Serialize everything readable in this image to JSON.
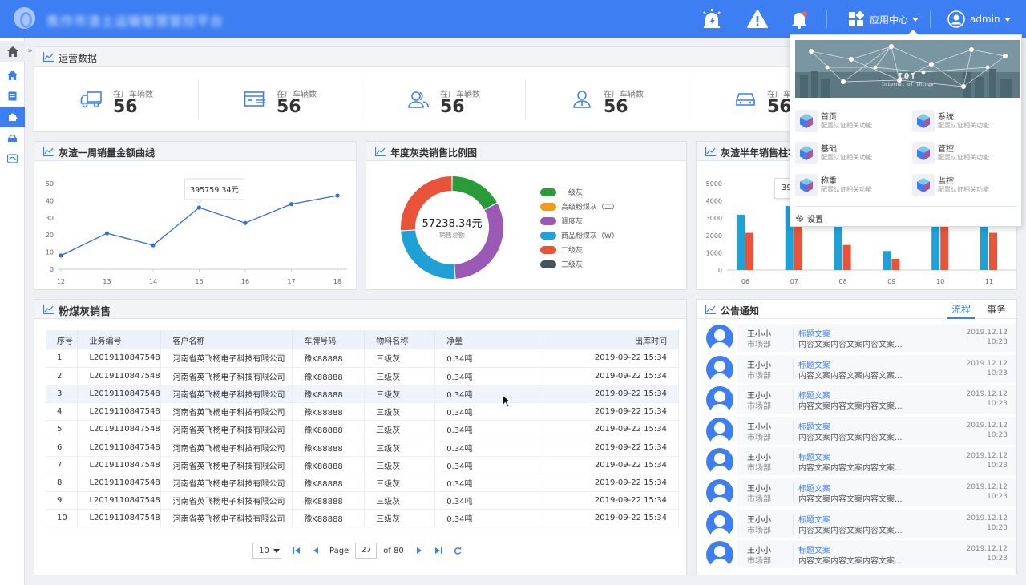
{
  "header": {
    "brand": "焦作市渣土运输智慧管控平台",
    "app_center": "应用中心",
    "user": "admin",
    "icons": [
      "alarm-icon",
      "warning-icon",
      "bell-icon"
    ]
  },
  "ops": {
    "title": "运营数据",
    "stats": [
      {
        "label": "在厂车辆数",
        "value": "56",
        "icon": "truck-icon"
      },
      {
        "label": "在厂车辆数",
        "value": "56",
        "icon": "card-icon"
      },
      {
        "label": "在厂车辆数",
        "value": "56",
        "icon": "users-icon"
      },
      {
        "label": "在厂车辆数",
        "value": "56",
        "icon": "driver-icon"
      },
      {
        "label": "在厂车辆数",
        "value": "56",
        "icon": "car-icon"
      }
    ]
  },
  "line_panel": {
    "title": "灰渣一周销量金额曲线",
    "tooltip": "395759.34元"
  },
  "donut_panel": {
    "title": "年度灰类销售比例图",
    "center_value": "57238.34元",
    "center_label": "销售总额"
  },
  "bar_panel": {
    "title": "灰渣半年销售柱状图",
    "tooltip_partial": "39"
  },
  "table_panel": {
    "title": "粉煤灰销售",
    "headers": [
      "序号",
      "业务编号",
      "客户名称",
      "车牌号码",
      "物料名称",
      "净量",
      "出库时间"
    ],
    "rows": [
      [
        "1",
        "L2019110847548",
        "河南省英飞杨电子科技有限公司",
        "豫K88888",
        "三级灰",
        "0.34吨",
        "2019-09-22  15:34"
      ],
      [
        "2",
        "L2019110847548",
        "河南省英飞杨电子科技有限公司",
        "豫K88888",
        "三级灰",
        "0.34吨",
        "2019-09-22  15:34"
      ],
      [
        "3",
        "L2019110847548",
        "河南省英飞杨电子科技有限公司",
        "豫K88888",
        "三级灰",
        "0.34吨",
        "2019-09-22  15:34"
      ],
      [
        "4",
        "L2019110847548",
        "河南省英飞杨电子科技有限公司",
        "豫K88888",
        "三级灰",
        "0.34吨",
        "2019-09-22  15:34"
      ],
      [
        "5",
        "L2019110847548",
        "河南省英飞杨电子科技有限公司",
        "豫K88888",
        "三级灰",
        "0.34吨",
        "2019-09-22  15:34"
      ],
      [
        "6",
        "L2019110847548",
        "河南省英飞杨电子科技有限公司",
        "豫K88888",
        "三级灰",
        "0.34吨",
        "2019-09-22  15:34"
      ],
      [
        "7",
        "L2019110847548",
        "河南省英飞杨电子科技有限公司",
        "豫K88888",
        "三级灰",
        "0.34吨",
        "2019-09-22  15:34"
      ],
      [
        "8",
        "L2019110847548",
        "河南省英飞杨电子科技有限公司",
        "豫K88888",
        "三级灰",
        "0.34吨",
        "2019-09-22  15:34"
      ],
      [
        "9",
        "L2019110847548",
        "河南省英飞杨电子科技有限公司",
        "豫K88888",
        "三级灰",
        "0.34吨",
        "2019-09-22  15:34"
      ],
      [
        "10",
        "L2019110847548",
        "河南省英飞杨电子科技有限公司",
        "豫K88888",
        "三级灰",
        "0.34吨",
        "2019-09-22  15:34"
      ]
    ],
    "highlighted_row": 3,
    "pager": {
      "page_size": "10",
      "page_label": "Page",
      "page": "27",
      "of_label": "of 80"
    }
  },
  "notice_panel": {
    "title": "公告通知",
    "tabs": [
      "流程",
      "事务"
    ],
    "active_tab": 0,
    "items": [
      {
        "name": "王小小",
        "dept": "市场部",
        "title": "标题文案",
        "content": "内容文案内容文案内容文案...",
        "date": "2019.12.12",
        "time": "10:23"
      },
      {
        "name": "王小小",
        "dept": "市场部",
        "title": "标题文案",
        "content": "内容文案内容文案内容文案...",
        "date": "2019.12.12",
        "time": "10:23"
      },
      {
        "name": "王小小",
        "dept": "市场部",
        "title": "标题文案",
        "content": "内容文案内容文案内容文案...",
        "date": "2019.12.12",
        "time": "10:23"
      },
      {
        "name": "王小小",
        "dept": "市场部",
        "title": "标题文案",
        "content": "内容文案内容文案内容文案...",
        "date": "2019.12.12",
        "time": "10:23"
      },
      {
        "name": "王小小",
        "dept": "市场部",
        "title": "标题文案",
        "content": "内容文案内容文案内容文案...",
        "date": "2019.12.12",
        "time": "10:23"
      },
      {
        "name": "王小小",
        "dept": "市场部",
        "title": "标题文案",
        "content": "内容文案内容文案内容文案...",
        "date": "2019.12.12",
        "time": "10:23"
      },
      {
        "name": "王小小",
        "dept": "市场部",
        "title": "标题文案",
        "content": "内容文案内容文案内容文案...",
        "date": "2019.12.12",
        "time": "10:23"
      },
      {
        "name": "王小小",
        "dept": "市场部",
        "title": "标题文案",
        "content": "内容文案内容文案内容文案...",
        "date": "2019.12.12",
        "time": "10:23"
      }
    ]
  },
  "app_menu": {
    "banner_title": "IOT",
    "banner_subtitle": "Internet of things",
    "apps": [
      {
        "name": "首页",
        "desc": "配置认证相关功能"
      },
      {
        "name": "系统",
        "desc": "配置认证相关功能"
      },
      {
        "name": "基础",
        "desc": "配置认证相关功能"
      },
      {
        "name": "管控",
        "desc": "配置认证相关功能"
      },
      {
        "name": "称重",
        "desc": "配置认证相关功能"
      },
      {
        "name": "监控",
        "desc": "配置认证相关功能"
      }
    ],
    "settings": "设置"
  },
  "colors": {
    "primary": "#3d7ff2",
    "green": "#2a9b3a",
    "orange": "#f29a1d",
    "purple": "#9b59b6",
    "cyan": "#1fa0d6",
    "red": "#e8533a",
    "slate": "#46525e"
  },
  "chart_data": [
    {
      "type": "line",
      "title": "灰渣一周销量金额曲线",
      "x": [
        "12",
        "13",
        "14",
        "15",
        "16",
        "17",
        "18"
      ],
      "series": [
        {
          "values": [
            8,
            21,
            14,
            36,
            27,
            38,
            43
          ]
        }
      ],
      "ylim": [
        0,
        50
      ],
      "yticks": [
        0,
        10,
        20,
        30,
        40,
        50
      ],
      "grid": false,
      "tooltip": {
        "x": "15",
        "text": "395759.34元"
      }
    },
    {
      "type": "pie",
      "title": "年度灰类销售比例图",
      "labels": [
        "一级灰",
        "高级粉煤灰（二）",
        "调度灰",
        "商品粉煤灰（W）",
        "二级灰",
        "三级灰"
      ],
      "values": [
        17,
        0,
        32,
        25,
        26,
        0
      ],
      "colors": [
        "#2a9b3a",
        "#f29a1d",
        "#9b59b6",
        "#1fa0d6",
        "#e8533a",
        "#46525e"
      ],
      "legend": "right"
    },
    {
      "type": "bar",
      "title": "灰渣半年销售柱状图",
      "categories": [
        "06",
        "07",
        "08",
        "09",
        "10",
        "11"
      ],
      "series": [
        {
          "values": [
            3200,
            3700,
            3700,
            1100,
            3700,
            3700
          ],
          "color": "#1fa0d6"
        },
        {
          "values": [
            2150,
            2700,
            1450,
            650,
            2700,
            2150
          ],
          "color": "#e8533a"
        }
      ],
      "ylim": [
        0,
        5000
      ],
      "yticks": [
        0,
        1000,
        2000,
        3000,
        4000,
        5000
      ]
    }
  ]
}
